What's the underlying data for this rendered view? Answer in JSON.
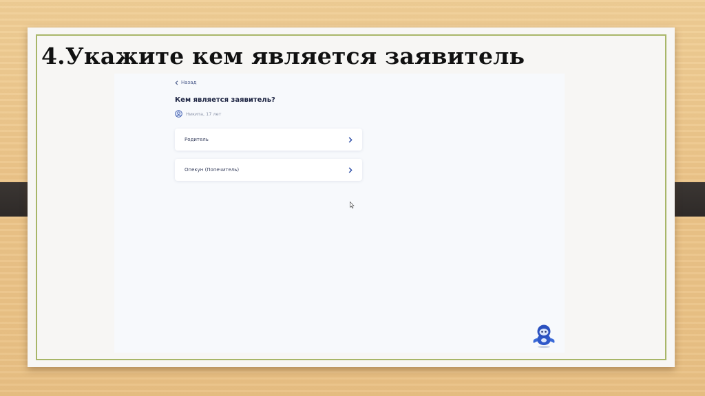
{
  "slide": {
    "title": "4.Укажите кем является заявитель"
  },
  "app": {
    "back_label": "Назад",
    "question": "Кем является заявитель?",
    "child_info": "Никита, 17 лет",
    "options": [
      {
        "label": "Родитель"
      },
      {
        "label": "Опекун (Попечитель)"
      }
    ]
  },
  "icons": {
    "back": "chevron-left-icon",
    "child": "child-avatar-icon",
    "option_arrow": "chevron-right-icon",
    "cursor": "mouse-cursor-icon",
    "assistant": "robot-assistant-icon"
  },
  "colors": {
    "accent": "#2f4fa8",
    "frame_border": "#a8b668",
    "side_tab": "#332f2d"
  }
}
